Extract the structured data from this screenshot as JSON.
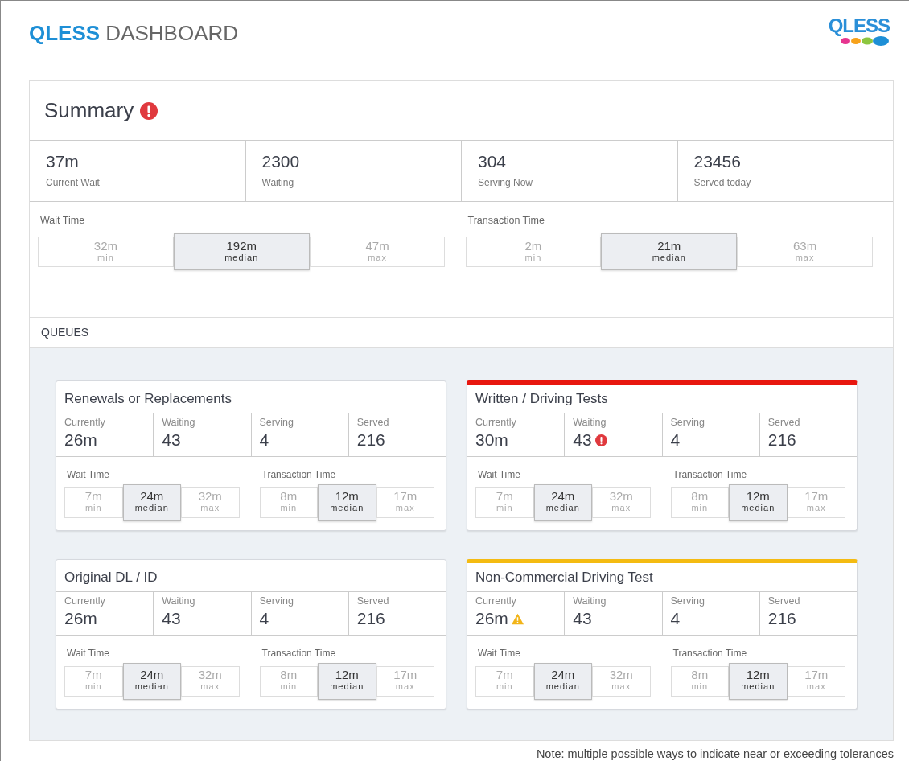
{
  "header": {
    "brand": "QLESS",
    "title": "DASHBOARD",
    "logo_text": "QLESS"
  },
  "summary": {
    "title": "Summary",
    "error": true,
    "stats": [
      {
        "value": "37m",
        "label": "Current Wait"
      },
      {
        "value": "2300",
        "label": "Waiting"
      },
      {
        "value": "304",
        "label": "Serving Now"
      },
      {
        "value": "23456",
        "label": "Served today"
      }
    ],
    "timings": [
      {
        "label": "Wait Time",
        "segments": [
          {
            "value": "32m",
            "label": "min",
            "highlighted": false
          },
          {
            "value": "192m",
            "label": "median",
            "highlighted": true
          },
          {
            "value": "47m",
            "label": "max",
            "highlighted": false
          }
        ]
      },
      {
        "label": "Transaction Time",
        "segments": [
          {
            "value": "2m",
            "label": "min",
            "highlighted": false
          },
          {
            "value": "21m",
            "label": "median",
            "highlighted": true
          },
          {
            "value": "63m",
            "label": "max",
            "highlighted": false
          }
        ]
      }
    ]
  },
  "queues_label": "QUEUES",
  "queues": [
    {
      "title": "Renewals or Replacements",
      "error": false,
      "warning": false,
      "stats": [
        {
          "label": "Currently",
          "value": "26m",
          "error": false,
          "warning": false
        },
        {
          "label": "Waiting",
          "value": "43",
          "error": false,
          "warning": false
        },
        {
          "label": "Serving",
          "value": "4",
          "error": false,
          "warning": false
        },
        {
          "label": "Served",
          "value": "216",
          "error": false,
          "warning": false
        }
      ],
      "timings": [
        {
          "label": "Wait Time",
          "segments": [
            {
              "value": "7m",
              "label": "min",
              "highlighted": false
            },
            {
              "value": "24m",
              "label": "median",
              "highlighted": true
            },
            {
              "value": "32m",
              "label": "max",
              "highlighted": false
            }
          ]
        },
        {
          "label": "Transaction Time",
          "segments": [
            {
              "value": "8m",
              "label": "min",
              "highlighted": false
            },
            {
              "value": "12m",
              "label": "median",
              "highlighted": true
            },
            {
              "value": "17m",
              "label": "max",
              "highlighted": false
            }
          ]
        }
      ]
    },
    {
      "title": "Written / Driving Tests",
      "error": true,
      "warning": false,
      "stats": [
        {
          "label": "Currently",
          "value": "30m",
          "error": false,
          "warning": false
        },
        {
          "label": "Waiting",
          "value": "43",
          "error": true,
          "warning": false
        },
        {
          "label": "Serving",
          "value": "4",
          "error": false,
          "warning": false
        },
        {
          "label": "Served",
          "value": "216",
          "error": false,
          "warning": false
        }
      ],
      "timings": [
        {
          "label": "Wait Time",
          "segments": [
            {
              "value": "7m",
              "label": "min",
              "highlighted": false
            },
            {
              "value": "24m",
              "label": "median",
              "highlighted": true
            },
            {
              "value": "32m",
              "label": "max",
              "highlighted": false
            }
          ]
        },
        {
          "label": "Transaction Time",
          "segments": [
            {
              "value": "8m",
              "label": "min",
              "highlighted": false
            },
            {
              "value": "12m",
              "label": "median",
              "highlighted": true
            },
            {
              "value": "17m",
              "label": "max",
              "highlighted": false
            }
          ]
        }
      ]
    },
    {
      "title": "Original DL / ID",
      "error": false,
      "warning": false,
      "stats": [
        {
          "label": "Currently",
          "value": "26m",
          "error": false,
          "warning": false
        },
        {
          "label": "Waiting",
          "value": "43",
          "error": false,
          "warning": false
        },
        {
          "label": "Serving",
          "value": "4",
          "error": false,
          "warning": false
        },
        {
          "label": "Served",
          "value": "216",
          "error": false,
          "warning": false
        }
      ],
      "timings": [
        {
          "label": "Wait Time",
          "segments": [
            {
              "value": "7m",
              "label": "min",
              "highlighted": false
            },
            {
              "value": "24m",
              "label": "median",
              "highlighted": true
            },
            {
              "value": "32m",
              "label": "max",
              "highlighted": false
            }
          ]
        },
        {
          "label": "Transaction Time",
          "segments": [
            {
              "value": "8m",
              "label": "min",
              "highlighted": false
            },
            {
              "value": "12m",
              "label": "median",
              "highlighted": true
            },
            {
              "value": "17m",
              "label": "max",
              "highlighted": false
            }
          ]
        }
      ]
    },
    {
      "title": "Non-Commercial Driving Test",
      "error": false,
      "warning": true,
      "stats": [
        {
          "label": "Currently",
          "value": "26m",
          "error": false,
          "warning": true
        },
        {
          "label": "Waiting",
          "value": "43",
          "error": false,
          "warning": false
        },
        {
          "label": "Serving",
          "value": "4",
          "error": false,
          "warning": false
        },
        {
          "label": "Served",
          "value": "216",
          "error": false,
          "warning": false
        }
      ],
      "timings": [
        {
          "label": "Wait Time",
          "segments": [
            {
              "value": "7m",
              "label": "min",
              "highlighted": false
            },
            {
              "value": "24m",
              "label": "median",
              "highlighted": true
            },
            {
              "value": "32m",
              "label": "max",
              "highlighted": false
            }
          ]
        },
        {
          "label": "Transaction Time",
          "segments": [
            {
              "value": "8m",
              "label": "min",
              "highlighted": false
            },
            {
              "value": "12m",
              "label": "median",
              "highlighted": true
            },
            {
              "value": "17m",
              "label": "max",
              "highlighted": false
            }
          ]
        }
      ]
    }
  ],
  "note": "Note: multiple possible ways to indicate near or exceeding tolerances"
}
